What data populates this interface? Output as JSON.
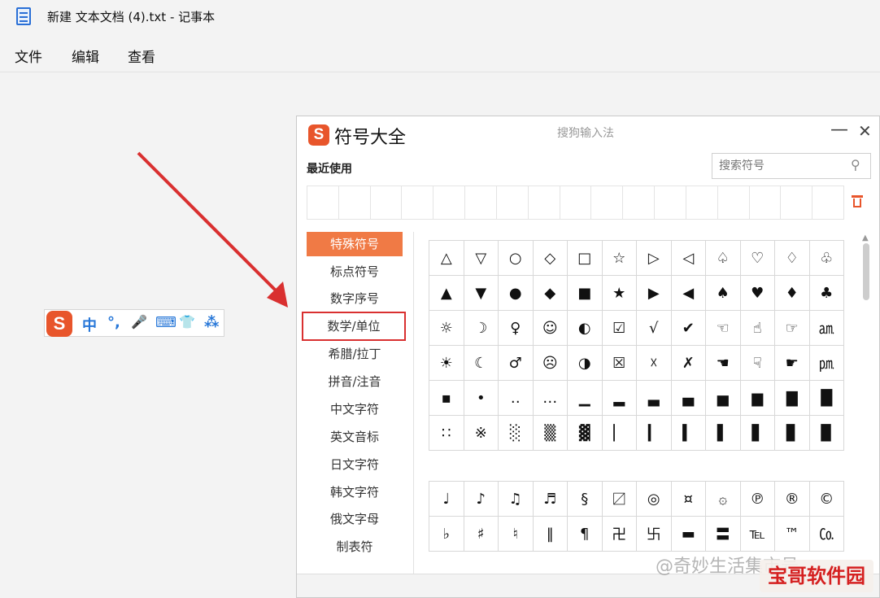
{
  "window": {
    "title": "新建 文本文档 (4).txt - 记事本"
  },
  "menu": {
    "file": "文件",
    "edit": "编辑",
    "view": "查看"
  },
  "ime_bar": {
    "logo": "S",
    "items": [
      "中",
      "°,",
      "🎤",
      "⌨",
      "👕",
      "⁂"
    ]
  },
  "panel": {
    "logo": "S",
    "title": "符号大全",
    "subtitle": "搜狗输入法",
    "minimize": "—",
    "close": "✕",
    "recent_label": "最近使用",
    "search_placeholder": "搜索符号",
    "categories": [
      "特殊符号",
      "标点符号",
      "数字序号",
      "数学/单位",
      "希腊/拉丁",
      "拼音/注音",
      "中文字符",
      "英文音标",
      "日文字符",
      "韩文字符",
      "俄文字母",
      "制表符"
    ],
    "active_category": "特殊符号",
    "highlighted_category": "数学/单位",
    "symbols_group1": [
      [
        "△",
        "▽",
        "○",
        "◇",
        "□",
        "☆",
        "▷",
        "◁",
        "♤",
        "♡",
        "♢",
        "♧"
      ],
      [
        "▲",
        "▼",
        "●",
        "◆",
        "■",
        "★",
        "▶",
        "◀",
        "♠",
        "♥",
        "♦",
        "♣"
      ],
      [
        "☼",
        "☽",
        "♀",
        "☺",
        "◐",
        "☑",
        "√",
        "✔",
        "☜",
        "☝",
        "☞",
        "㏂"
      ],
      [
        "☀",
        "☾",
        "♂",
        "☹",
        "◑",
        "☒",
        "☓",
        "✗",
        "☚",
        "☟",
        "☛",
        "㏘"
      ],
      [
        "▪",
        "•",
        "‥",
        "…",
        "▁",
        "▂",
        "▃",
        "▄",
        "▅",
        "▆",
        "▇",
        "█"
      ],
      [
        "∷",
        "※",
        "░",
        "▒",
        "▓",
        "▏",
        "▎",
        "▍",
        "▌",
        "▋",
        "▊",
        "▉"
      ]
    ],
    "symbols_group2": [
      [
        "♩",
        "♪",
        "♫",
        "♬",
        "§",
        "〼",
        "◎",
        "¤",
        "۞",
        "℗",
        "®",
        "©"
      ],
      [
        "♭",
        "♯",
        "♮",
        "‖",
        "¶",
        "卍",
        "卐",
        "▬",
        "〓",
        "℡",
        "™",
        "㏇"
      ]
    ]
  },
  "watermark": {
    "text": "@奇妙生活集市号",
    "badge": "宝哥软件园"
  },
  "colors": {
    "accent": "#e8552b",
    "active_tab": "#f07a45",
    "highlight_border": "#d93030",
    "arrow": "#d93030",
    "ime_blue": "#2777d8"
  }
}
